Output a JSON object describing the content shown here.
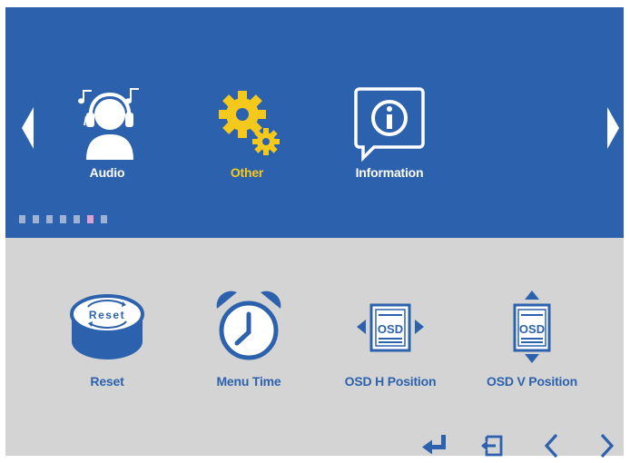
{
  "menu": {
    "categories": [
      {
        "label": "Audio",
        "icon": "headphones-user-icon",
        "selected": false
      },
      {
        "label": "Other",
        "icon": "gears-icon",
        "selected": true
      },
      {
        "label": "Information",
        "icon": "info-icon",
        "selected": false
      }
    ],
    "page_dots": {
      "count": 7,
      "active_index": 5
    },
    "items": [
      {
        "label": "Reset",
        "icon": "reset-icon",
        "icon_text": "Reset"
      },
      {
        "label": "Menu Time",
        "icon": "alarm-clock-icon"
      },
      {
        "label": "OSD H Position",
        "icon": "osd-horizontal-icon",
        "icon_text": "OSD"
      },
      {
        "label": "OSD V Position",
        "icon": "osd-vertical-icon",
        "icon_text": "OSD"
      }
    ],
    "nav_buttons": [
      "enter-icon",
      "exit-icon",
      "chevron-left-icon",
      "chevron-right-icon"
    ]
  },
  "colors": {
    "top_panel": "#2c62ad",
    "bottom_panel": "#d4d4d4",
    "selected_label": "#f5c81c",
    "accent": "#2c62ad"
  }
}
